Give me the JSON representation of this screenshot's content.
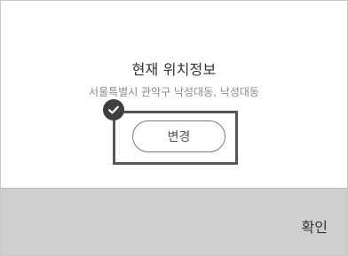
{
  "dialog": {
    "title": "현재 위치정보",
    "address": "서울특별시 관악구 낙성대동, 낙성대동",
    "change_label": "변경",
    "confirm_label": "확인"
  },
  "colors": {
    "background": "#ffffff",
    "footer": "#cfcfcf",
    "badge": "#3f3f3f",
    "border": "#555555"
  },
  "icons": {
    "check": "check-icon"
  }
}
